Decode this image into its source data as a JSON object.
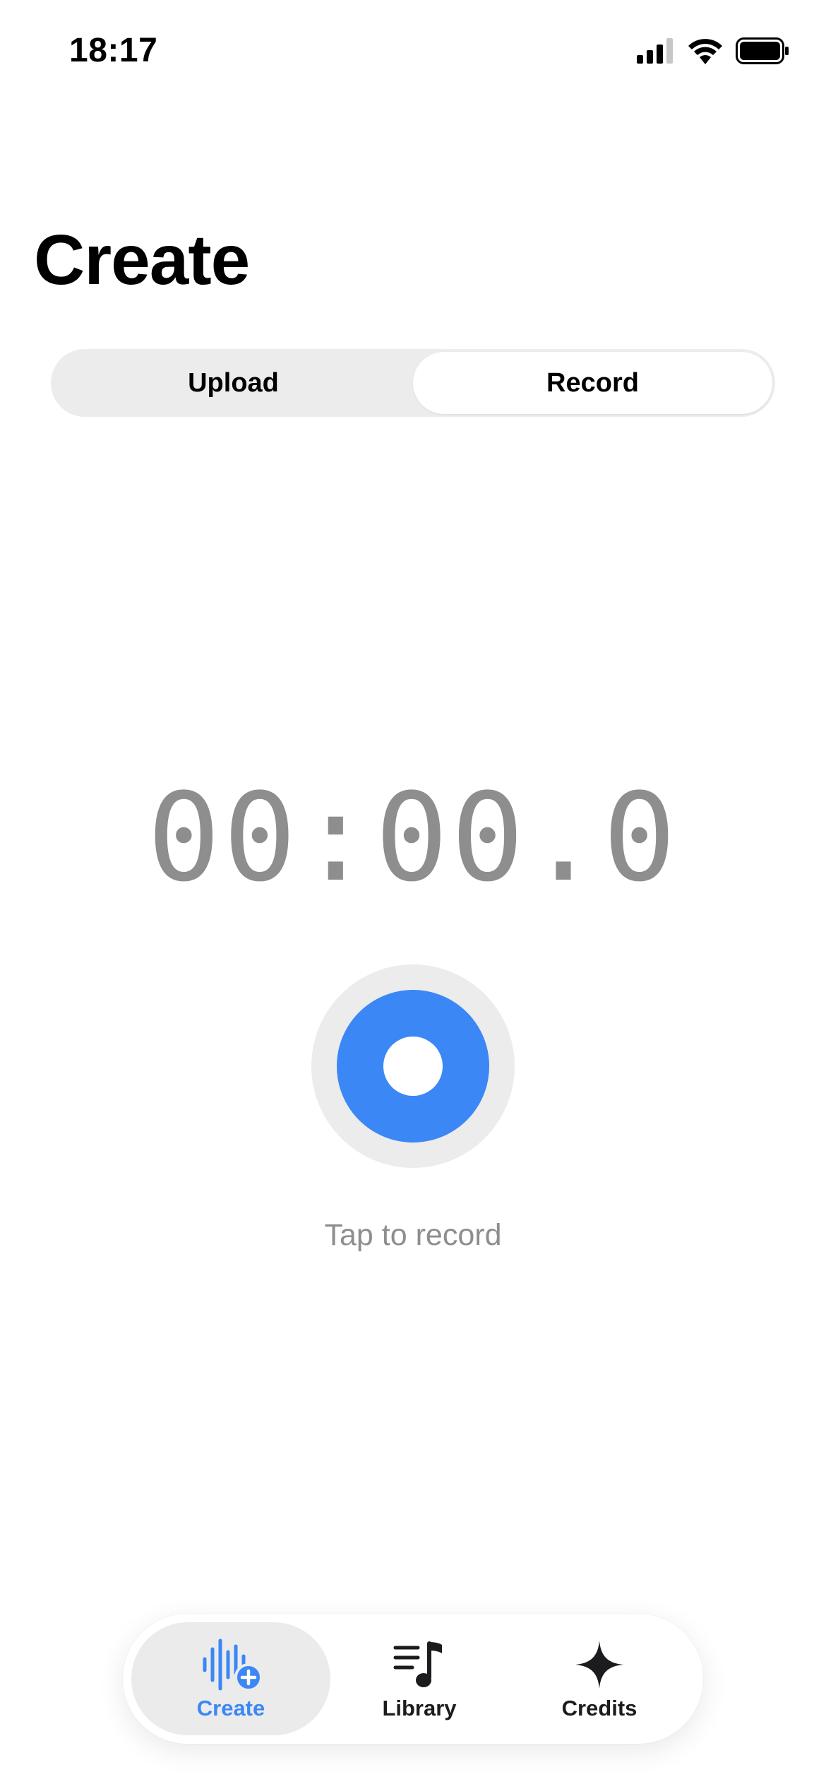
{
  "status_bar": {
    "time": "18:17",
    "icons": [
      "cellular-signal-icon",
      "wifi-icon",
      "battery-icon"
    ]
  },
  "page": {
    "title": "Create"
  },
  "segmented_control": {
    "options": [
      {
        "label": "Upload",
        "selected": false
      },
      {
        "label": "Record",
        "selected": true
      }
    ]
  },
  "recorder": {
    "timer": "00:00.0",
    "hint": "Tap to record",
    "button_color": "#3b87f5"
  },
  "tab_bar": {
    "tabs": [
      {
        "label": "Create",
        "icon": "waveform-plus-icon",
        "selected": true
      },
      {
        "label": "Library",
        "icon": "music-list-icon",
        "selected": false
      },
      {
        "label": "Credits",
        "icon": "sparkle-icon",
        "selected": false
      }
    ],
    "accent_color": "#3b87f5"
  }
}
